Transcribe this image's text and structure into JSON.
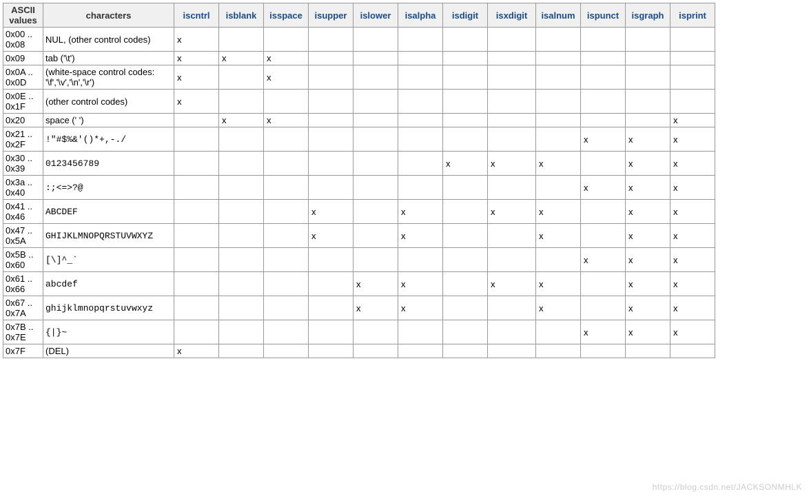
{
  "headers": {
    "ascii": "ASCII values",
    "chars": "characters",
    "fns": [
      "iscntrl",
      "isblank",
      "isspace",
      "isupper",
      "islower",
      "isalpha",
      "isdigit",
      "isxdigit",
      "isalnum",
      "ispunct",
      "isgraph",
      "isprint"
    ]
  },
  "mark": "x",
  "rows": [
    {
      "ascii": "0x00 .. 0x08",
      "chars": "NUL, (other control codes)",
      "mono": false,
      "x": [
        true,
        false,
        false,
        false,
        false,
        false,
        false,
        false,
        false,
        false,
        false,
        false
      ]
    },
    {
      "ascii": "0x09",
      "chars": "tab ('\\t')",
      "mono": false,
      "x": [
        true,
        true,
        true,
        false,
        false,
        false,
        false,
        false,
        false,
        false,
        false,
        false
      ]
    },
    {
      "ascii": "0x0A .. 0x0D",
      "chars": "(white-space control codes: '\\f','\\v','\\n','\\r')",
      "mono": false,
      "x": [
        true,
        false,
        true,
        false,
        false,
        false,
        false,
        false,
        false,
        false,
        false,
        false
      ]
    },
    {
      "ascii": "0x0E .. 0x1F",
      "chars": "(other control codes)",
      "mono": false,
      "x": [
        true,
        false,
        false,
        false,
        false,
        false,
        false,
        false,
        false,
        false,
        false,
        false
      ]
    },
    {
      "ascii": "0x20",
      "chars": "space (' ')",
      "mono": false,
      "x": [
        false,
        true,
        true,
        false,
        false,
        false,
        false,
        false,
        false,
        false,
        false,
        true
      ]
    },
    {
      "ascii": "0x21 .. 0x2F",
      "chars": "!\"#$%&'()*+,-./",
      "mono": true,
      "x": [
        false,
        false,
        false,
        false,
        false,
        false,
        false,
        false,
        false,
        true,
        true,
        true
      ]
    },
    {
      "ascii": "0x30 .. 0x39",
      "chars": "0123456789",
      "mono": true,
      "x": [
        false,
        false,
        false,
        false,
        false,
        false,
        true,
        true,
        true,
        false,
        true,
        true
      ]
    },
    {
      "ascii": "0x3a .. 0x40",
      "chars": ":;<=>?@",
      "mono": true,
      "x": [
        false,
        false,
        false,
        false,
        false,
        false,
        false,
        false,
        false,
        true,
        true,
        true
      ]
    },
    {
      "ascii": "0x41 .. 0x46",
      "chars": "ABCDEF",
      "mono": true,
      "x": [
        false,
        false,
        false,
        true,
        false,
        true,
        false,
        true,
        true,
        false,
        true,
        true
      ]
    },
    {
      "ascii": "0x47 .. 0x5A",
      "chars": "GHIJKLMNOPQRSTUVWXYZ",
      "mono": true,
      "x": [
        false,
        false,
        false,
        true,
        false,
        true,
        false,
        false,
        true,
        false,
        true,
        true
      ]
    },
    {
      "ascii": "0x5B .. 0x60",
      "chars": "[\\]^_`",
      "mono": true,
      "x": [
        false,
        false,
        false,
        false,
        false,
        false,
        false,
        false,
        false,
        true,
        true,
        true
      ]
    },
    {
      "ascii": "0x61 .. 0x66",
      "chars": "abcdef",
      "mono": true,
      "x": [
        false,
        false,
        false,
        false,
        true,
        true,
        false,
        true,
        true,
        false,
        true,
        true
      ]
    },
    {
      "ascii": "0x67 .. 0x7A",
      "chars": "ghijklmnopqrstuvwxyz",
      "mono": true,
      "x": [
        false,
        false,
        false,
        false,
        true,
        true,
        false,
        false,
        true,
        false,
        true,
        true
      ]
    },
    {
      "ascii": "0x7B .. 0x7E",
      "chars": "{|}~",
      "mono": true,
      "x": [
        false,
        false,
        false,
        false,
        false,
        false,
        false,
        false,
        false,
        true,
        true,
        true
      ]
    },
    {
      "ascii": "0x7F",
      "chars": "(DEL)",
      "mono": false,
      "x": [
        true,
        false,
        false,
        false,
        false,
        false,
        false,
        false,
        false,
        false,
        false,
        false
      ]
    }
  ],
  "watermark": "https://blog.csdn.net/JACKSONMHLK"
}
